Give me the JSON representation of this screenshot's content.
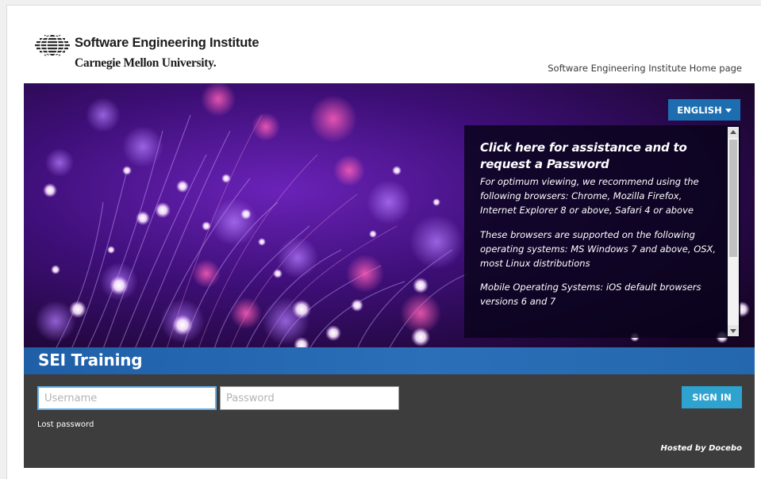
{
  "header": {
    "logo_line1": "Software Engineering Institute",
    "logo_line2": "Carnegie Mellon University.",
    "home_link": "Software Engineering Institute Home page"
  },
  "language": {
    "selected": "ENGLISH"
  },
  "info_panel": {
    "title": "Click here for assistance and to request a Password",
    "paragraphs": [
      "For optimum viewing, we recommend using the following browsers: Chrome, Mozilla Firefox, Internet Explorer 8 or above, Safari 4 or above",
      "These browsers are supported on the following operating systems: MS Windows 7 and above, OSX, most Linux distributions",
      "Mobile Operating Systems: iOS default browsers versions 6 and 7"
    ]
  },
  "title_band": {
    "title": "SEI Training"
  },
  "login": {
    "username_placeholder": "Username",
    "password_placeholder": "Password",
    "signin_label": "SIGN IN",
    "lost_password": "Lost password",
    "hosted_by": "Hosted by Docebo"
  },
  "colors": {
    "brand_blue": "#1c6eb0",
    "signin_blue": "#2ea3d0",
    "login_bg": "#3d3d3d",
    "hero_purple": "#5a1a9c"
  },
  "icons": {
    "logo": "sei-globe-logo-icon",
    "dropdown": "caret-down-icon"
  }
}
